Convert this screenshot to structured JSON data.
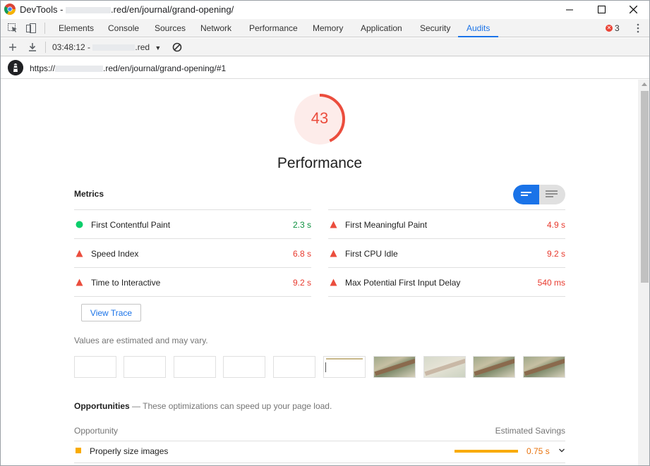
{
  "window": {
    "title_prefix": "DevTools - ",
    "title_suffix": ".red/en/journal/grand-opening/"
  },
  "tabs": [
    "Elements",
    "Console",
    "Sources",
    "Network",
    "Performance",
    "Memory",
    "Application",
    "Security",
    "Audits"
  ],
  "active_tab": "Audits",
  "error_count": "3",
  "audit_toolbar": {
    "time_prefix": "03:48:12 - ",
    "time_suffix": ".red"
  },
  "url": {
    "prefix": "https://",
    "suffix": ".red/en/journal/grand-opening/#1"
  },
  "score": {
    "value": "43",
    "fraction": 0.43,
    "color": "#eb4d3d",
    "bg": "#fdecea"
  },
  "category_title": "Performance",
  "metrics_heading": "Metrics",
  "metrics": [
    {
      "label": "First Contentful Paint",
      "value": "2.3 s",
      "status": "pass",
      "color": "#0a8f3d",
      "icon": "green-circle-icon"
    },
    {
      "label": "First Meaningful Paint",
      "value": "4.9 s",
      "status": "fail",
      "color": "#e8392d",
      "icon": "red-triangle-icon"
    },
    {
      "label": "Speed Index",
      "value": "6.8 s",
      "status": "fail",
      "color": "#e8392d",
      "icon": "red-triangle-icon"
    },
    {
      "label": "First CPU Idle",
      "value": "9.2 s",
      "status": "fail",
      "color": "#e8392d",
      "icon": "red-triangle-icon"
    },
    {
      "label": "Time to Interactive",
      "value": "9.2 s",
      "status": "fail",
      "color": "#e8392d",
      "icon": "red-triangle-icon"
    },
    {
      "label": "Max Potential First Input Delay",
      "value": "540 ms",
      "status": "fail",
      "color": "#e8392d",
      "icon": "red-triangle-icon"
    }
  ],
  "view_trace_label": "View Trace",
  "estimate_note": "Values are estimated and may vary.",
  "opportunities": {
    "heading": "Opportunities",
    "subtitle": " — These optimizations can speed up your page load.",
    "col_left": "Opportunity",
    "col_right": "Estimated Savings",
    "items": [
      {
        "label": "Properly size images",
        "savings": "0.75 s",
        "bar_fraction": 1.0
      }
    ]
  }
}
